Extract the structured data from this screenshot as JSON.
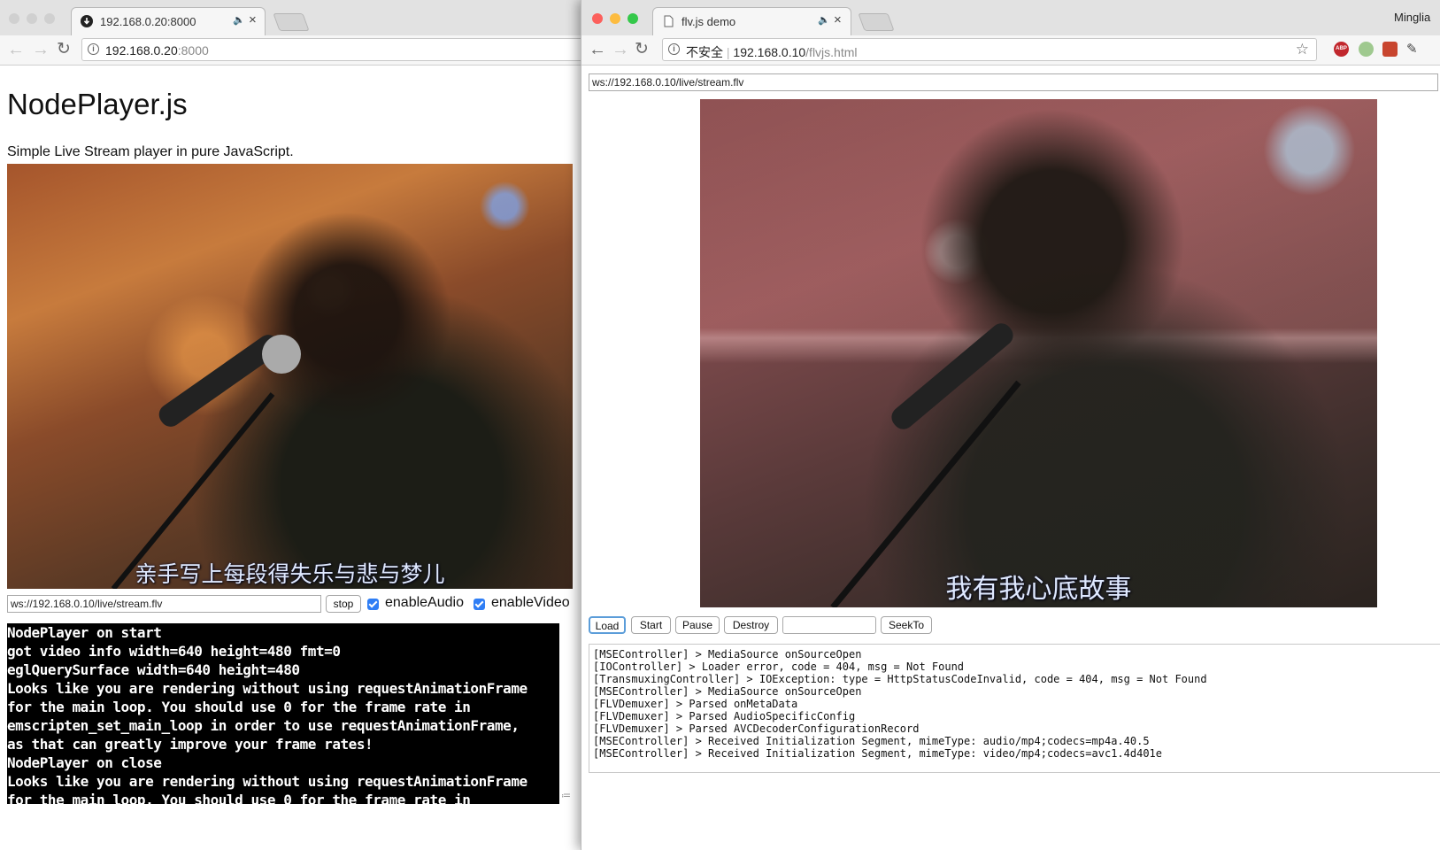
{
  "left_window": {
    "tab_title": "192.168.0.20:8000",
    "address_host": "192.168.0.20",
    "address_port": ":8000",
    "page": {
      "title": "NodePlayer.js",
      "description": "Simple Live Stream player in pure JavaScript.",
      "video_subtitle": "亲手写上每段得失乐与悲与梦儿",
      "stream_url": "ws://192.168.0.10/live/stream.flv",
      "stop_label": "stop",
      "enable_audio_label": "enableAudio",
      "enable_video_label": "enableVideo",
      "enable_audio_checked": true,
      "enable_video_checked": true,
      "console_lines": [
        "NodePlayer on start",
        "got video info width=640 height=480 fmt=0",
        "eglQuerySurface width=640 height=480",
        "Looks like you are rendering without using requestAnimationFrame",
        "for the main loop. You should use 0 for the frame rate in",
        "emscripten_set_main_loop in order to use requestAnimationFrame,",
        "as that can greatly improve your frame rates!",
        "NodePlayer on close",
        "Looks like you are rendering without using requestAnimationFrame",
        "for the main loop. You should use 0 for the frame rate in"
      ]
    }
  },
  "right_window": {
    "tab_title": "flv.js demo",
    "profile_name": "Minglia",
    "security_label": "不安全",
    "address_host": "192.168.0.10",
    "address_path": "/flvjs.html",
    "page": {
      "stream_url": "ws://192.168.0.10/live/stream.flv",
      "video_subtitle": "我有我心底故事",
      "buttons": {
        "load": "Load",
        "start": "Start",
        "pause": "Pause",
        "destroy": "Destroy",
        "seek_to": "SeekTo"
      },
      "seek_value": "",
      "log_lines": [
        "[MSEController] > MediaSource onSourceOpen",
        "[IOController] > Loader error, code = 404, msg = Not Found",
        "[TransmuxingController] > IOException: type = HttpStatusCodeInvalid, code = 404, msg = Not Found",
        "[MSEController] > MediaSource onSourceOpen",
        "[FLVDemuxer] > Parsed onMetaData",
        "[FLVDemuxer] > Parsed AudioSpecificConfig",
        "[FLVDemuxer] > Parsed AVCDecoderConfigurationRecord",
        "[MSEController] > Received Initialization Segment, mimeType: audio/mp4;codecs=mp4a.40.5",
        "[MSEController] > Received Initialization Segment, mimeType: video/mp4;codecs=avc1.4d401e"
      ]
    }
  },
  "icons": {
    "abp_label": "ABP"
  }
}
